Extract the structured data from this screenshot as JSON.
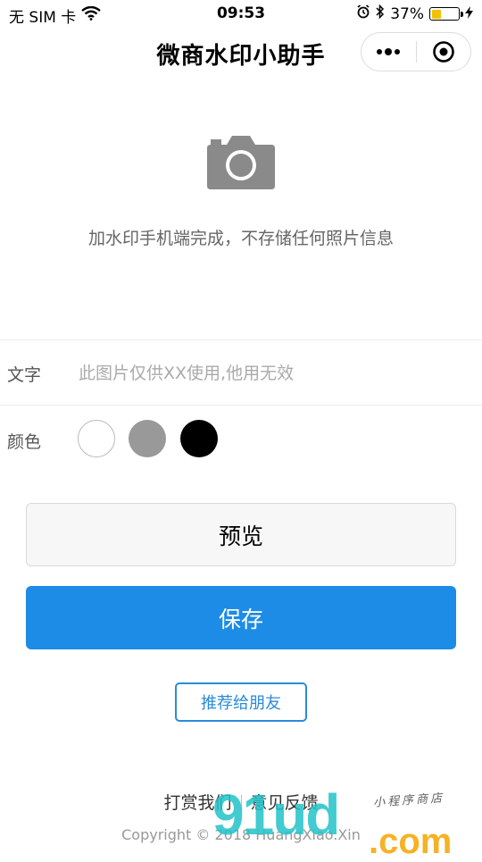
{
  "status_bar": {
    "carrier": "无 SIM 卡",
    "time": "09:53",
    "battery": "37%",
    "battery_level": 0.37
  },
  "navbar": {
    "title": "微商水印小助手"
  },
  "camera": {
    "hint": "加水印手机端完成，不存储任何照片信息"
  },
  "form": {
    "text_label": "文字",
    "text_placeholder": "此图片仅供XX使用,他用无效",
    "color_label": "颜色",
    "colors": [
      "#ffffff",
      "#999999",
      "#000000"
    ]
  },
  "buttons": {
    "preview": "预览",
    "save": "保存",
    "share": "推荐给朋友"
  },
  "footer": {
    "reward": "打赏我们",
    "feedback": "意见反馈",
    "copyright": "Copyright © 2018 HuangXiao.Xin"
  },
  "watermark": {
    "big": "91ud",
    "com": ".com",
    "small": "小程序商店"
  },
  "theme": {
    "accent": "#1c8ce6",
    "share_blue": "#2b8bd8",
    "camera_gray": "#8a8a8a"
  }
}
